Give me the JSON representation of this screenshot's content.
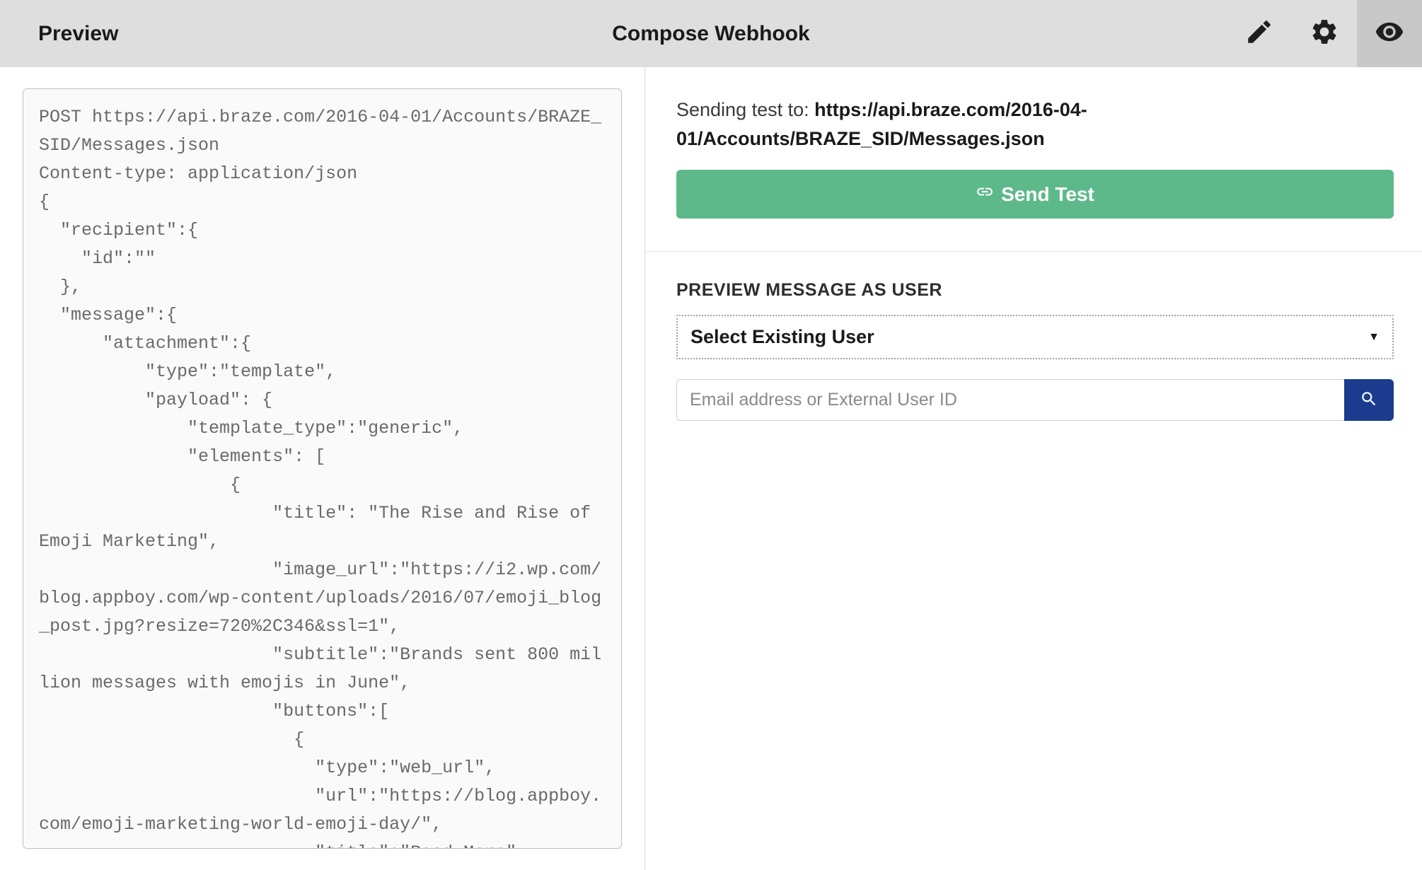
{
  "header": {
    "left_title": "Preview",
    "center_title": "Compose Webhook"
  },
  "code_preview": "POST https://api.braze.com/2016-04-01/Accounts/BRAZE_SID/Messages.json\nContent-type: application/json\n{\n  \"recipient\":{\n    \"id\":\"\"\n  },\n  \"message\":{\n      \"attachment\":{\n          \"type\":\"template\",\n          \"payload\": {\n              \"template_type\":\"generic\",\n              \"elements\": [\n                  {\n                      \"title\": \"The Rise and Rise of Emoji Marketing\",\n                      \"image_url\":\"https://i2.wp.com/blog.appboy.com/wp-content/uploads/2016/07/emoji_blog_post.jpg?resize=720%2C346&ssl=1\",\n                      \"subtitle\":\"Brands sent 800 million messages with emojis in June\",\n                      \"buttons\":[\n                        {\n                          \"type\":\"web_url\",\n                          \"url\":\"https://blog.appboy.com/emoji-marketing-world-emoji-day/\",\n                          \"title\":\"Read More\"",
  "test": {
    "sending_label": "Sending test to: ",
    "sending_url": "https://api.braze.com/2016-04-01/Accounts/BRAZE_SID/Messages.json",
    "send_button_label": "Send Test"
  },
  "preview_user": {
    "section_label": "PREVIEW MESSAGE AS USER",
    "select_label": "Select Existing User",
    "search_placeholder": "Email address or External User ID"
  }
}
